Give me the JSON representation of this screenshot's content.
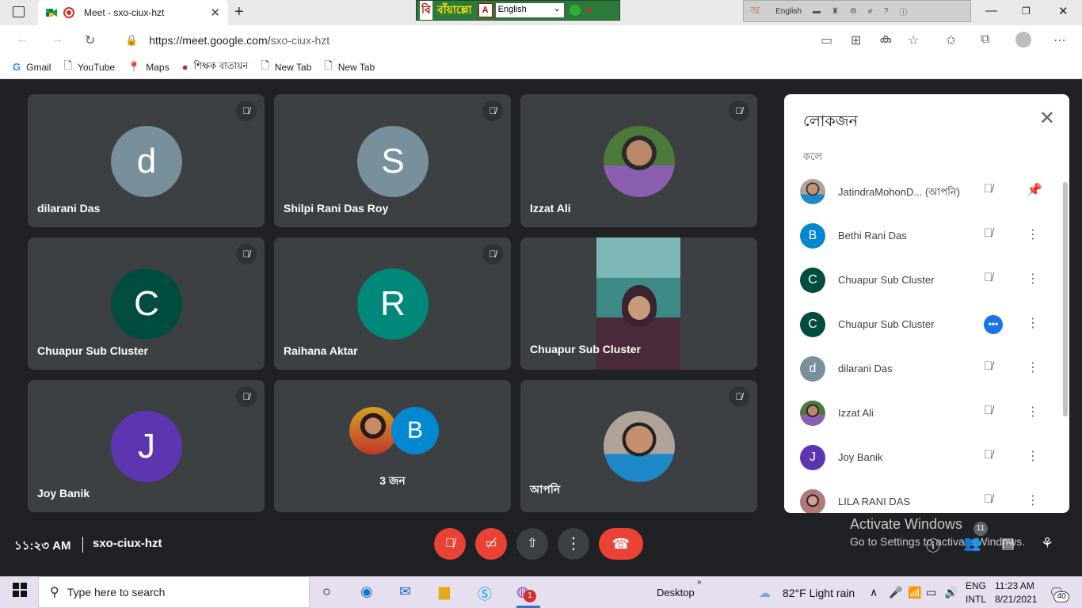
{
  "browser": {
    "tab_title": "Meet - sxo-ciux-hzt",
    "url_host": "https://meet.google.com/",
    "url_path": "sxo-ciux-hzt",
    "ime_toolbar": {
      "brand": "বাঁয়াল্লো",
      "language": "English"
    },
    "lang_bar": {
      "language": "English"
    },
    "bookmarks": [
      "Gmail",
      "YouTube",
      "Maps",
      "শিক্ষক বাতায়ন",
      "New Tab",
      "New Tab"
    ]
  },
  "tiles": [
    {
      "name": "dilarani Das",
      "initial": "d",
      "color": "#78909c",
      "muted": true
    },
    {
      "name": "Shilpi Rani Das Roy",
      "initial": "S",
      "color": "#78909c",
      "muted": true
    },
    {
      "name": "Izzat Ali",
      "initial": "",
      "color": "#6b8f4a",
      "muted": true
    },
    {
      "name": "Chuapur Sub Cluster",
      "initial": "C",
      "color": "#004d40",
      "muted": true
    },
    {
      "name": "Raihana Aktar",
      "initial": "R",
      "color": "#00897b",
      "muted": true
    },
    {
      "name": "Chuapur Sub Cluster",
      "initial": "",
      "color": "#4a6f74",
      "muted": false
    },
    {
      "name": "Joy Banik",
      "initial": "J",
      "color": "#5e35b1",
      "muted": true
    },
    {
      "name": "3 জন",
      "initial": "B",
      "color": "#0288d1",
      "muted": false
    },
    {
      "name": "আপনি",
      "initial": "",
      "color": "#c47a4a",
      "muted": true
    }
  ],
  "panel": {
    "title": "লোকজন",
    "section": "কলে",
    "people": [
      {
        "name": "JatindraMohonD... (আপনি)",
        "initial": "",
        "color": "#a0705a",
        "action": "pin"
      },
      {
        "name": "Bethi Rani Das",
        "initial": "B",
        "color": "#0288d1",
        "action": "more"
      },
      {
        "name": "Chuapur Sub Cluster",
        "initial": "C",
        "color": "#004d40",
        "action": "more"
      },
      {
        "name": "Chuapur Sub Cluster",
        "initial": "C",
        "color": "#004d40",
        "action": "more",
        "speaking": true
      },
      {
        "name": "dilarani Das",
        "initial": "d",
        "color": "#78909c",
        "action": "more"
      },
      {
        "name": "Izzat Ali",
        "initial": "",
        "color": "#6b8f4a",
        "action": "more"
      },
      {
        "name": "Joy Banik",
        "initial": "J",
        "color": "#5e35b1",
        "action": "more"
      },
      {
        "name": "LILA RANI DAS",
        "initial": "",
        "color": "#b07a7a",
        "action": "more"
      }
    ]
  },
  "bottom": {
    "time": "১১:২৩ AM",
    "meeting_code": "sxo-ciux-hzt",
    "participant_count": "11",
    "activate_title": "Activate Windows",
    "activate_sub": "Go to Settings to activate Windows."
  },
  "taskbar": {
    "search_placeholder": "Type here to search",
    "desktop": "Desktop",
    "weather": "82°F  Light rain",
    "lang1": "ENG",
    "lang2": "INTL",
    "clock_time": "11:23 AM",
    "clock_date": "8/21/2021",
    "notifications": "40",
    "chrome_badge": "1"
  }
}
